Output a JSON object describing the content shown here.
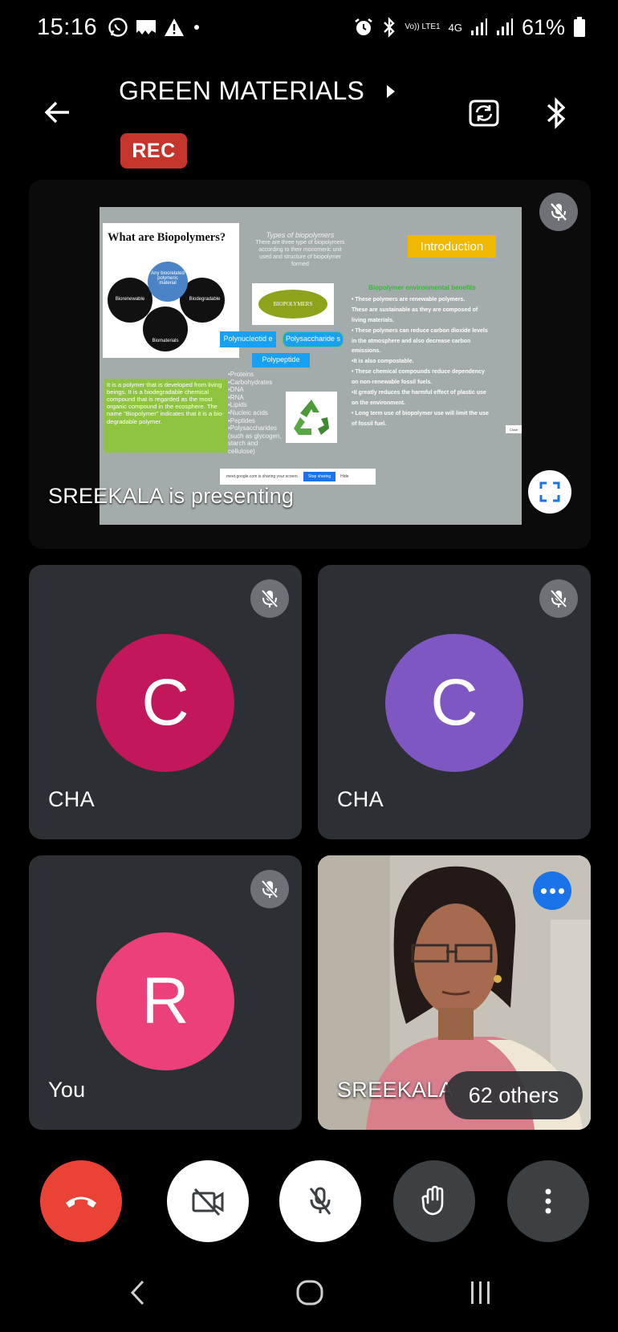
{
  "status_bar": {
    "time": "15:16",
    "network_label": "Vo)) LTE1",
    "net_type": "4G",
    "battery": "61%"
  },
  "header": {
    "title": "GREEN MATERIALS",
    "rec_label": "REC",
    "icons": [
      "back-arrow-icon",
      "chevron-right-icon",
      "switch-camera-icon",
      "bluetooth-icon"
    ]
  },
  "presentation": {
    "label": "SREEKALA is presenting",
    "slide": {
      "heading": "What are Biopolymers?",
      "center_circle": "Any bioorelated polymeric material",
      "circle_left": "Biorenewable",
      "circle_right": "Biodegradable",
      "circle_bottom": "Biomaterials",
      "types_title": "Types of biopolymers",
      "types_text": "There are three type of biopolymers according to their monomeric unit used and structure of biopolymer formed",
      "intro_label": "Introduction",
      "biopoly_label": "BIOPOLYMERS",
      "chip1": "Polynucleotid e",
      "chip2": "Polysaccharide s",
      "chip3": "Polypeptide",
      "green_text": "It is a polymer that is developed from living beings. It is a biodegradable chemical compound that is regarded as the most organic compound in the ecosphere. The name \"Biopolymer\" indicates that it is a bio-degradable polymer.",
      "list": [
        "•Proteins",
        "•Carbohydrates",
        "•DNA",
        "•RNA",
        "•Lipids",
        "•Nucleic acids",
        "•Peptides",
        "•Polysaccharides (such as glycogen, starch and cellulose)"
      ],
      "benefits_title": "Biopolymer environmental benefits",
      "benefits": [
        "• These polymers are renewable polymers.",
        "These are sustainable as they are composed of living materials.",
        "• These polymers can reduce carbon dioxide levels in the atmosphere and also decrease carbon emissions.",
        "•It is also compostable.",
        "• These chemical compounds reduce dependency on non-renewable fossil fuels.",
        "•It greatly reduces the harmful effect of plastic use on the environment.",
        "• Long term use of biopolymer use will limit the use of fossil fuel."
      ],
      "share_text": "meet.google.com is sharing your screen.",
      "stop_sharing": "Stop sharing",
      "hide": "Hide",
      "close_tab": "Close"
    }
  },
  "participants": [
    {
      "name": "CHA",
      "initial": "C",
      "color": "#c2185b"
    },
    {
      "name": "CHA",
      "initial": "C",
      "color": "#7e57c2"
    },
    {
      "name": "You",
      "initial": "R",
      "color": "#ec407a"
    },
    {
      "name": "SREEKALA",
      "video": true
    }
  ],
  "others_label": "62 others",
  "controls": [
    "end-call-icon",
    "camera-off-icon",
    "mic-off-icon",
    "raise-hand-icon",
    "more-vertical-icon"
  ],
  "nav": [
    "back-nav-icon",
    "home-nav-icon",
    "recents-nav-icon"
  ]
}
